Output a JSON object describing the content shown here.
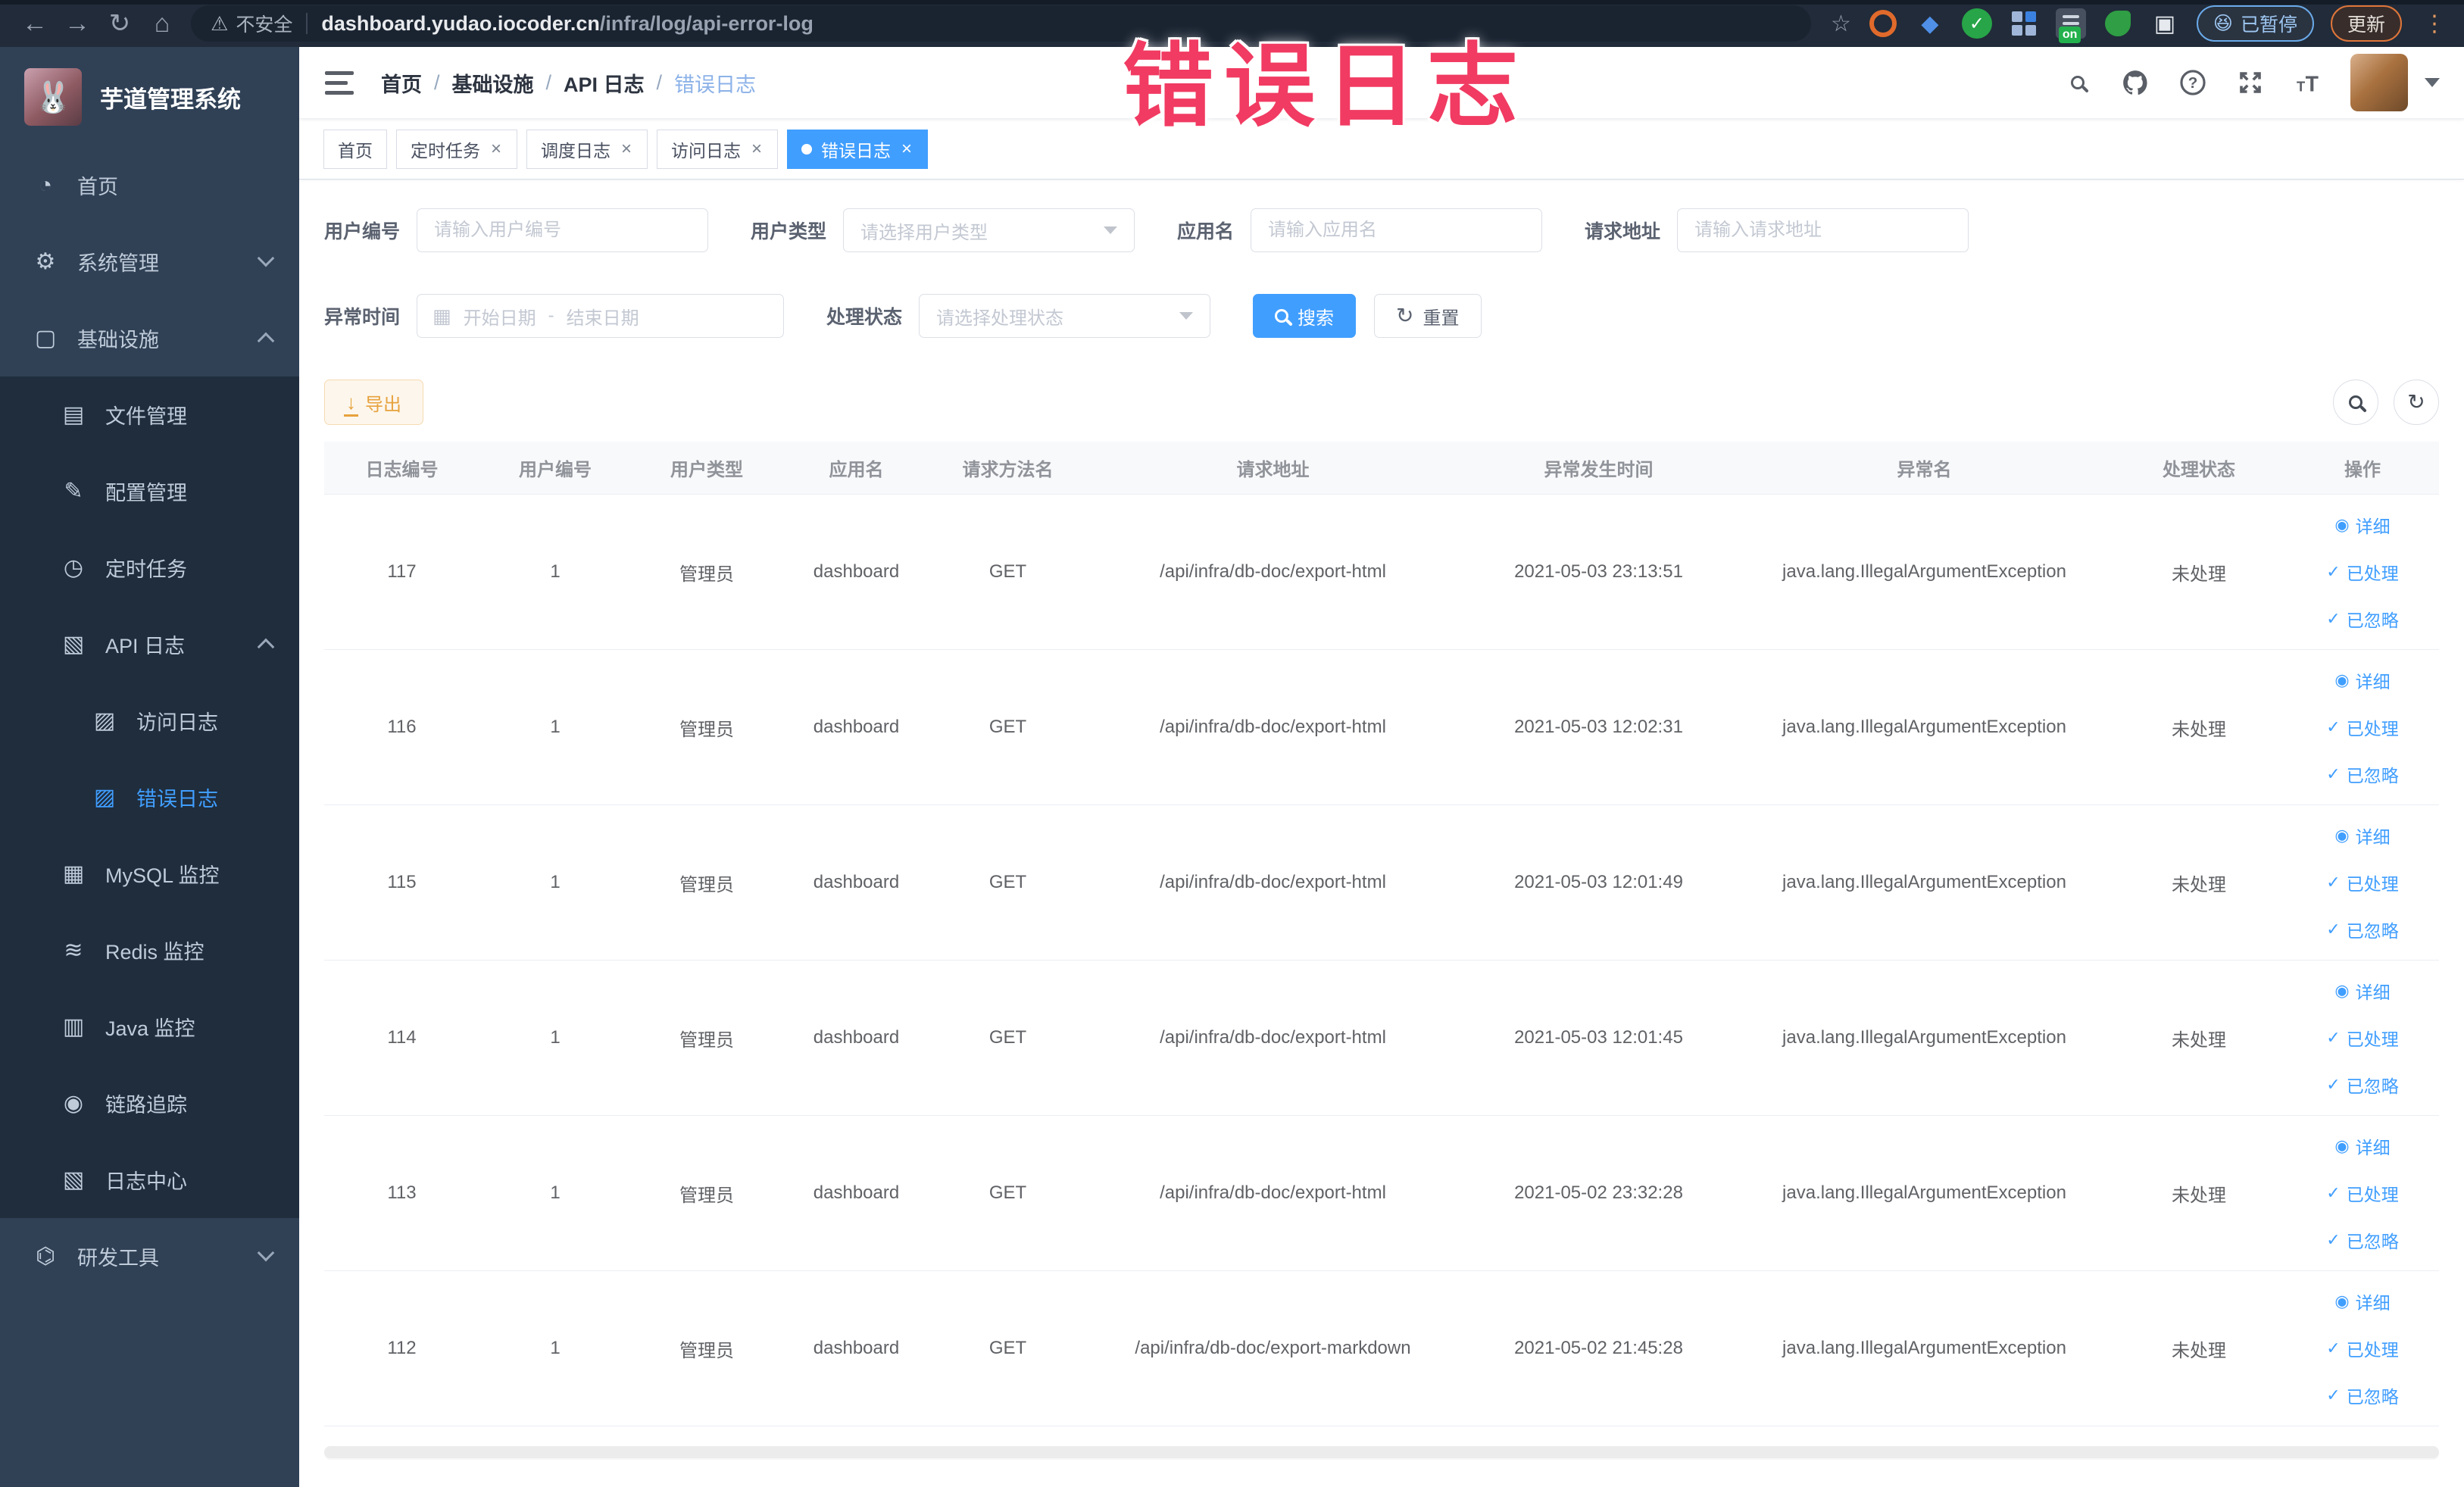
{
  "colors": {
    "accent": "#409eff",
    "warning": "#e6a23c",
    "sidebar_bg": "#304156",
    "submenu_bg": "#1f2d3d",
    "overlay_pink": "#f13b62"
  },
  "overlay_title": "错误日志",
  "browser": {
    "security_label": "不安全",
    "url_host": "dashboard.yudao.iocoder.cn",
    "url_path": "/infra/log/api-error-log",
    "ext_on_badge": "on",
    "paused_emoji": "😆",
    "paused_label": "已暂停",
    "update_label": "更新"
  },
  "sidebar": {
    "app_title": "芋道管理系统",
    "items": [
      {
        "label": "首页"
      },
      {
        "label": "系统管理"
      },
      {
        "label": "基础设施"
      },
      {
        "label": "文件管理"
      },
      {
        "label": "配置管理"
      },
      {
        "label": "定时任务"
      },
      {
        "label": "API 日志"
      },
      {
        "label": "访问日志"
      },
      {
        "label": "错误日志"
      },
      {
        "label": "MySQL 监控"
      },
      {
        "label": "Redis 监控"
      },
      {
        "label": "Java 监控"
      },
      {
        "label": "链路追踪"
      },
      {
        "label": "日志中心"
      },
      {
        "label": "研发工具"
      }
    ]
  },
  "breadcrumb": {
    "separator": "/",
    "items": [
      "首页",
      "基础设施",
      "API 日志",
      "错误日志"
    ]
  },
  "tabs": [
    {
      "label": "首页"
    },
    {
      "label": "定时任务"
    },
    {
      "label": "调度日志"
    },
    {
      "label": "访问日志"
    },
    {
      "label": "错误日志"
    }
  ],
  "filters": {
    "user_id": {
      "label": "用户编号",
      "placeholder": "请输入用户编号"
    },
    "user_type": {
      "label": "用户类型",
      "placeholder": "请选择用户类型"
    },
    "app_name": {
      "label": "应用名",
      "placeholder": "请输入应用名"
    },
    "request_url": {
      "label": "请求地址",
      "placeholder": "请输入请求地址"
    },
    "exception_time": {
      "label": "异常时间",
      "start_placeholder": "开始日期",
      "separator": "-",
      "end_placeholder": "结束日期"
    },
    "process_status": {
      "label": "处理状态",
      "placeholder": "请选择处理状态"
    },
    "search_button": "搜索",
    "reset_button": "重置"
  },
  "toolbar": {
    "export_button": "导出"
  },
  "table": {
    "headers": [
      "日志编号",
      "用户编号",
      "用户类型",
      "应用名",
      "请求方法名",
      "请求地址",
      "异常发生时间",
      "异常名",
      "处理状态",
      "操作"
    ],
    "action_labels": {
      "detail": "详细",
      "processed": "已处理",
      "ignored": "已忽略"
    },
    "rows": [
      {
        "id": "117",
        "user_id": "1",
        "user_type": "管理员",
        "app_name": "dashboard",
        "method": "GET",
        "url": "/api/infra/db-doc/export-html",
        "time": "2021-05-03 23:13:51",
        "exception": "java.lang.IllegalArgumentException",
        "status": "未处理"
      },
      {
        "id": "116",
        "user_id": "1",
        "user_type": "管理员",
        "app_name": "dashboard",
        "method": "GET",
        "url": "/api/infra/db-doc/export-html",
        "time": "2021-05-03 12:02:31",
        "exception": "java.lang.IllegalArgumentException",
        "status": "未处理"
      },
      {
        "id": "115",
        "user_id": "1",
        "user_type": "管理员",
        "app_name": "dashboard",
        "method": "GET",
        "url": "/api/infra/db-doc/export-html",
        "time": "2021-05-03 12:01:49",
        "exception": "java.lang.IllegalArgumentException",
        "status": "未处理"
      },
      {
        "id": "114",
        "user_id": "1",
        "user_type": "管理员",
        "app_name": "dashboard",
        "method": "GET",
        "url": "/api/infra/db-doc/export-html",
        "time": "2021-05-03 12:01:45",
        "exception": "java.lang.IllegalArgumentException",
        "status": "未处理"
      },
      {
        "id": "113",
        "user_id": "1",
        "user_type": "管理员",
        "app_name": "dashboard",
        "method": "GET",
        "url": "/api/infra/db-doc/export-html",
        "time": "2021-05-02 23:32:28",
        "exception": "java.lang.IllegalArgumentException",
        "status": "未处理"
      },
      {
        "id": "112",
        "user_id": "1",
        "user_type": "管理员",
        "app_name": "dashboard",
        "method": "GET",
        "url": "/api/infra/db-doc/export-markdown",
        "time": "2021-05-02 21:45:28",
        "exception": "java.lang.IllegalArgumentException",
        "status": "未处理"
      }
    ]
  }
}
